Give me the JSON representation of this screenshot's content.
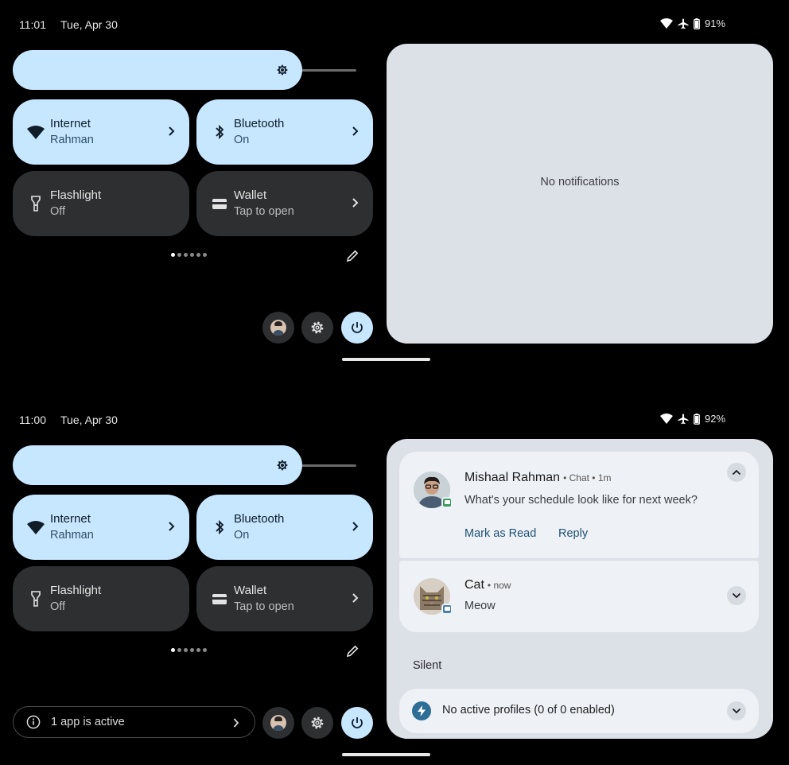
{
  "colors": {
    "background": "#000000",
    "tile_active": "#c6e7ff",
    "tile_inactive": "#2d2f31",
    "notification_shade": "#dce0e7",
    "notification_card": "#eef1f5",
    "action_text": "#1e5276"
  },
  "screenshots": [
    {
      "status_bar": {
        "time": "11:01",
        "date": "Tue, Apr 30",
        "battery": "91%",
        "icons": [
          "wifi-icon",
          "airplane-icon",
          "battery-icon"
        ]
      },
      "brightness": {
        "level": 0.84,
        "icon": "brightness-icon"
      },
      "tiles": [
        {
          "title": "Internet",
          "subtitle": "Rahman",
          "state": "active",
          "icon": "wifi-icon",
          "has_chevron": true
        },
        {
          "title": "Bluetooth",
          "subtitle": "On",
          "state": "active",
          "icon": "bluetooth-icon",
          "has_chevron": true
        },
        {
          "title": "Flashlight",
          "subtitle": "Off",
          "state": "inactive",
          "icon": "flashlight-icon",
          "has_chevron": false
        },
        {
          "title": "Wallet",
          "subtitle": "Tap to open",
          "state": "inactive",
          "icon": "wallet-icon",
          "has_chevron": true
        }
      ],
      "pager": {
        "pages": 6,
        "current": 1
      },
      "notifications": {
        "empty_text": "No notifications"
      }
    },
    {
      "status_bar": {
        "time": "11:00",
        "date": "Tue, Apr 30",
        "battery": "92%",
        "icons": [
          "wifi-icon",
          "airplane-icon",
          "battery-icon"
        ]
      },
      "brightness": {
        "level": 0.84,
        "icon": "brightness-icon"
      },
      "tiles": [
        {
          "title": "Internet",
          "subtitle": "Rahman",
          "state": "active",
          "icon": "wifi-icon",
          "has_chevron": true
        },
        {
          "title": "Bluetooth",
          "subtitle": "On",
          "state": "active",
          "icon": "bluetooth-icon",
          "has_chevron": true
        },
        {
          "title": "Flashlight",
          "subtitle": "Off",
          "state": "inactive",
          "icon": "flashlight-icon",
          "has_chevron": false
        },
        {
          "title": "Wallet",
          "subtitle": "Tap to open",
          "state": "inactive",
          "icon": "wallet-icon",
          "has_chevron": true
        }
      ],
      "pager": {
        "pages": 6,
        "current": 1
      },
      "active_apps": {
        "text": "1 app is active",
        "icon": "info-icon"
      },
      "notifications": {
        "items": [
          {
            "sender": "Mishaal Rahman",
            "app": "Chat",
            "time": "1m",
            "message": "What's your schedule look like for next week?",
            "actions": [
              "Mark as Read",
              "Reply"
            ],
            "expanded": true
          },
          {
            "sender": "Cat",
            "time": "now",
            "message": "Meow",
            "expanded": false
          }
        ],
        "section_label": "Silent",
        "silent_item": {
          "text": "No active profiles (0 of 0 enabled)",
          "icon": "profile-icon"
        }
      }
    }
  ]
}
